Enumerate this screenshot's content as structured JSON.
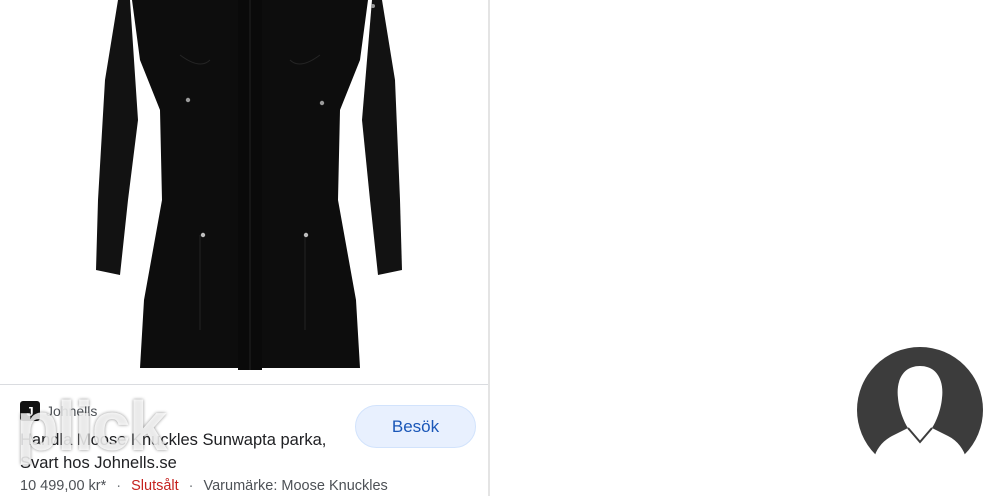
{
  "product": {
    "image_icon": "black-parka-product-image",
    "source": {
      "favicon_letter": "J",
      "name": "Johnells"
    },
    "title": "Handla Moose Knuckles Sunwapta parka, Svart hos Johnells.se",
    "price": "10 499,00 kr*",
    "separator": "·",
    "status": "Slutsålt",
    "brand": "Varumärke: Moose Knuckles",
    "visit_label": "Besök"
  },
  "overlay": {
    "watermark": "plick",
    "avatar_icon": "person-silhouette-icon"
  },
  "colors": {
    "visit_button_bg": "#e8f0fe",
    "visit_button_text": "#1a57b8",
    "status_red": "#c5221f",
    "avatar_bg": "#3c3c3c"
  }
}
